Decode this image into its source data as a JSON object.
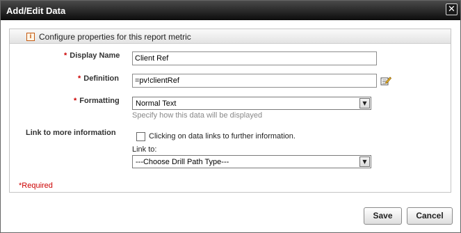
{
  "window": {
    "title": "Add/Edit Data",
    "close_glyph": "✕"
  },
  "panel": {
    "title": "Configure properties for this report metric",
    "info_icon_glyph": "i"
  },
  "form": {
    "required_mark": "*",
    "display_name": {
      "label": "Display Name",
      "value": "Client Ref"
    },
    "definition": {
      "label": "Definition",
      "value": "=pv!clientRef",
      "icon": "edit-expression-icon"
    },
    "formatting": {
      "label": "Formatting",
      "selected": "Normal Text",
      "hint": "Specify how this data will be displayed"
    },
    "link": {
      "label": "Link to more information",
      "checkbox_label": "Clicking on data links to further information.",
      "checked": false,
      "link_to_label": "Link to:",
      "drill_selected": "---Choose Drill Path Type---"
    },
    "required_note": "*Required"
  },
  "buttons": {
    "save": "Save",
    "cancel": "Cancel"
  },
  "colors": {
    "titlebar": "#1a1a1a",
    "required": "#cc0000",
    "hint": "#888888"
  },
  "dropdown_arrow": "▼"
}
